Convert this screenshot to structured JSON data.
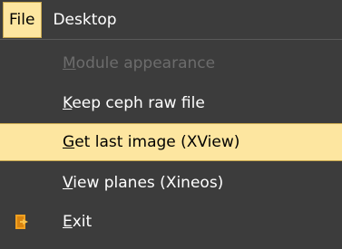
{
  "menubar": {
    "file": "File",
    "desktop": "Desktop"
  },
  "menu": {
    "items": [
      {
        "mnemonic": "M",
        "rest": "odule appearance",
        "enabled": false,
        "highlighted": false
      },
      {
        "mnemonic": "K",
        "rest": "eep ceph raw file",
        "enabled": true,
        "highlighted": false
      },
      {
        "mnemonic": "G",
        "rest": "et last image (XView)",
        "enabled": true,
        "highlighted": true
      },
      {
        "mnemonic": "V",
        "rest": "iew planes (Xineos)",
        "enabled": true,
        "highlighted": false
      },
      {
        "mnemonic": "E",
        "rest": "xit",
        "enabled": true,
        "highlighted": false,
        "icon": "exit-door-icon"
      }
    ]
  },
  "colors": {
    "menu_bg": "#3c3c3c",
    "highlight_bg": "#fde6a0",
    "highlight_border": "#c8a850",
    "disabled_text": "#6c6c6c",
    "icon_orange": "#f0a020"
  }
}
